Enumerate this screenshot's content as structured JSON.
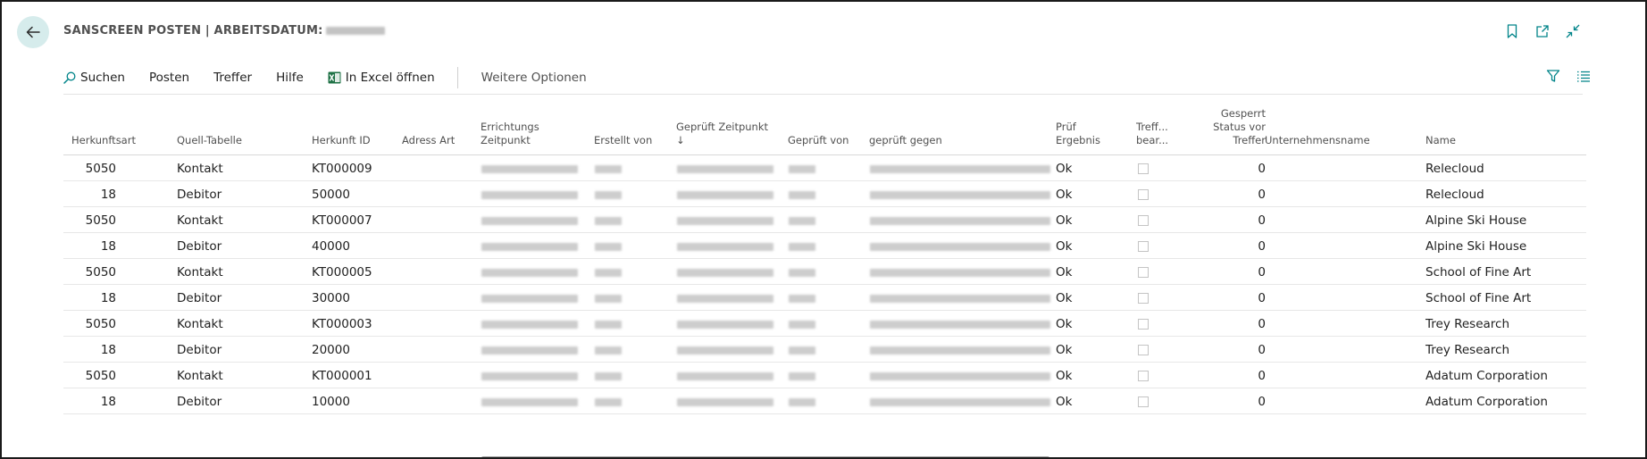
{
  "header": {
    "title": "SANSCREEN POSTEN | ARBEITSDATUM:"
  },
  "toolbar": {
    "search": "Suchen",
    "posten": "Posten",
    "treffer": "Treffer",
    "hilfe": "Hilfe",
    "excel": "In Excel öffnen",
    "more": "Weitere Optionen"
  },
  "columns": {
    "herkunftsart": "Herkunftsart",
    "quell": "Quell-Tabelle",
    "herkunft_id": "Herkunft ID",
    "adress_art": "Adress Art",
    "errichtung_1": "Errichtungs",
    "errichtung_2": "Zeitpunkt",
    "erstellt": "Erstellt von",
    "geprueft_zp_1": "Geprüft Zeitpunkt",
    "geprueft_zp_2": "↓",
    "geprueft_von": "Geprüft von",
    "gegen": "geprüft gegen",
    "pruef_1": "Prüf",
    "pruef_2": "Ergebnis",
    "treff_1": "Treff...",
    "treff_2": "bear...",
    "gesperrt_1": "Gesperrt",
    "gesperrt_2": "Status vor",
    "gesperrt_3": "Treffer",
    "unternehmen": "Unternehmensname",
    "name": "Name"
  },
  "rows": [
    {
      "art": "5050",
      "quell": "Kontakt",
      "id": "KT000009",
      "ergebnis": "Ok",
      "gesperrt": "0",
      "name": "Relecloud"
    },
    {
      "art": "18",
      "quell": "Debitor",
      "id": "50000",
      "ergebnis": "Ok",
      "gesperrt": "0",
      "name": "Relecloud"
    },
    {
      "art": "5050",
      "quell": "Kontakt",
      "id": "KT000007",
      "ergebnis": "Ok",
      "gesperrt": "0",
      "name": "Alpine Ski House"
    },
    {
      "art": "18",
      "quell": "Debitor",
      "id": "40000",
      "ergebnis": "Ok",
      "gesperrt": "0",
      "name": "Alpine Ski House"
    },
    {
      "art": "5050",
      "quell": "Kontakt",
      "id": "KT000005",
      "ergebnis": "Ok",
      "gesperrt": "0",
      "name": "School of Fine Art"
    },
    {
      "art": "18",
      "quell": "Debitor",
      "id": "30000",
      "ergebnis": "Ok",
      "gesperrt": "0",
      "name": "School of Fine Art"
    },
    {
      "art": "5050",
      "quell": "Kontakt",
      "id": "KT000003",
      "ergebnis": "Ok",
      "gesperrt": "0",
      "name": "Trey Research"
    },
    {
      "art": "18",
      "quell": "Debitor",
      "id": "20000",
      "ergebnis": "Ok",
      "gesperrt": "0",
      "name": "Trey Research"
    },
    {
      "art": "5050",
      "quell": "Kontakt",
      "id": "KT000001",
      "ergebnis": "Ok",
      "gesperrt": "0",
      "name": "Adatum Corporation"
    },
    {
      "art": "18",
      "quell": "Debitor",
      "id": "10000",
      "ergebnis": "Ok",
      "gesperrt": "0",
      "name": "Adatum Corporation"
    }
  ],
  "colors": {
    "accent": "#008489",
    "back_bg": "#d6ecec",
    "excel_green": "#1e7145"
  }
}
